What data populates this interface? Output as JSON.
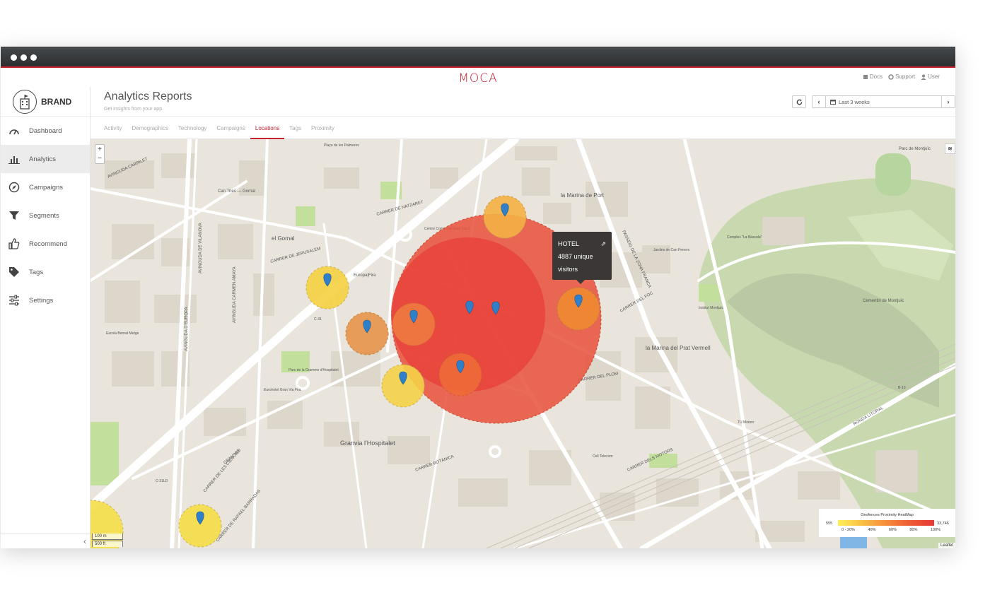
{
  "app": {
    "logo": "MOCA",
    "top_links": [
      {
        "icon": "book-icon",
        "label": "Docs"
      },
      {
        "icon": "lifebuoy-icon",
        "label": "Support"
      },
      {
        "icon": "user-icon",
        "label": "User"
      }
    ]
  },
  "sidebar": {
    "brand": "BRAND",
    "items": [
      {
        "icon": "speedometer-icon",
        "label": "Dashboard",
        "active": false
      },
      {
        "icon": "bar-chart-icon",
        "label": "Analytics",
        "active": true
      },
      {
        "icon": "compass-icon",
        "label": "Campaigns",
        "active": false
      },
      {
        "icon": "filter-icon",
        "label": "Segments",
        "active": false
      },
      {
        "icon": "thumbs-up-icon",
        "label": "Recommend",
        "active": false
      },
      {
        "icon": "tag-icon",
        "label": "Tags",
        "active": false
      },
      {
        "icon": "sliders-icon",
        "label": "Settings",
        "active": false
      }
    ],
    "collapse_glyph": "‹"
  },
  "header": {
    "title": "Analytics Reports",
    "subtitle": "Get insights from your app.",
    "date_range": "Last 3 weeks"
  },
  "tabs": [
    "Activity",
    "Demographics",
    "Technology",
    "Campaigns",
    "Locations",
    "Tags",
    "Proximity"
  ],
  "active_tab": "Locations",
  "map": {
    "zoom_in": "+",
    "zoom_out": "−",
    "scale_m": "100 m",
    "scale_ft": "500 ft",
    "attribution": "Leaflet",
    "labels": [
      "la Marina de Port",
      "el Gornal",
      "Granvia l'Hospitalet",
      "la Marina del Prat Vermell",
      "Parc de Montjuïc",
      "Cementiri de Montjuïc",
      "Europa|Fira",
      "Can Tries — Gornal",
      "GRAN VIA",
      "CARRER DEL FOC",
      "RONDA LITORAL",
      "CARRER DELS MOTORS",
      "PASSEIG DE LA ZONA FRANCA",
      "Complex \"La Bàscula\"",
      "Jardins de Can Ferrers",
      "Escola Bernat Metge",
      "Eurohotel Gran Via Fira",
      "Parc de la Gramme d'Hospitalet",
      "CARRER DEL PLOM",
      "AVINGUDA CARRILET",
      "Plaça de les Palmeres",
      "Centre Comercial Gran Via 2",
      "Institut Montjuïc",
      "Cell Telecom",
      "TU Motors",
      "B-10",
      "C-31",
      "C-31LD",
      "CARRER DE JERUSALEM",
      "CARRER DE NATZARET",
      "AVINGUDA DE VILANOVA",
      "CARRER BOTÀNICA",
      "CARRER DE LES CIÈNCIES",
      "AVINGUDA D'EUROPA",
      "CARRER DE RAFAEL BARRADAS",
      "AVINGUDA CARMEN AMAYA"
    ],
    "tooltip": {
      "title": "HOTEL",
      "line1": "4887 unique",
      "line2": "visitors"
    },
    "legend": {
      "title": "Geofences Proximity HeatMap",
      "min": "555",
      "max": "33,746",
      "ticks": [
        "0 - 20%",
        "40%",
        "60%",
        "80%",
        "100%"
      ],
      "colors": [
        "#ffee58",
        "#f9c045",
        "#f58c3a",
        "#ee5a34",
        "#e53935"
      ]
    }
  }
}
